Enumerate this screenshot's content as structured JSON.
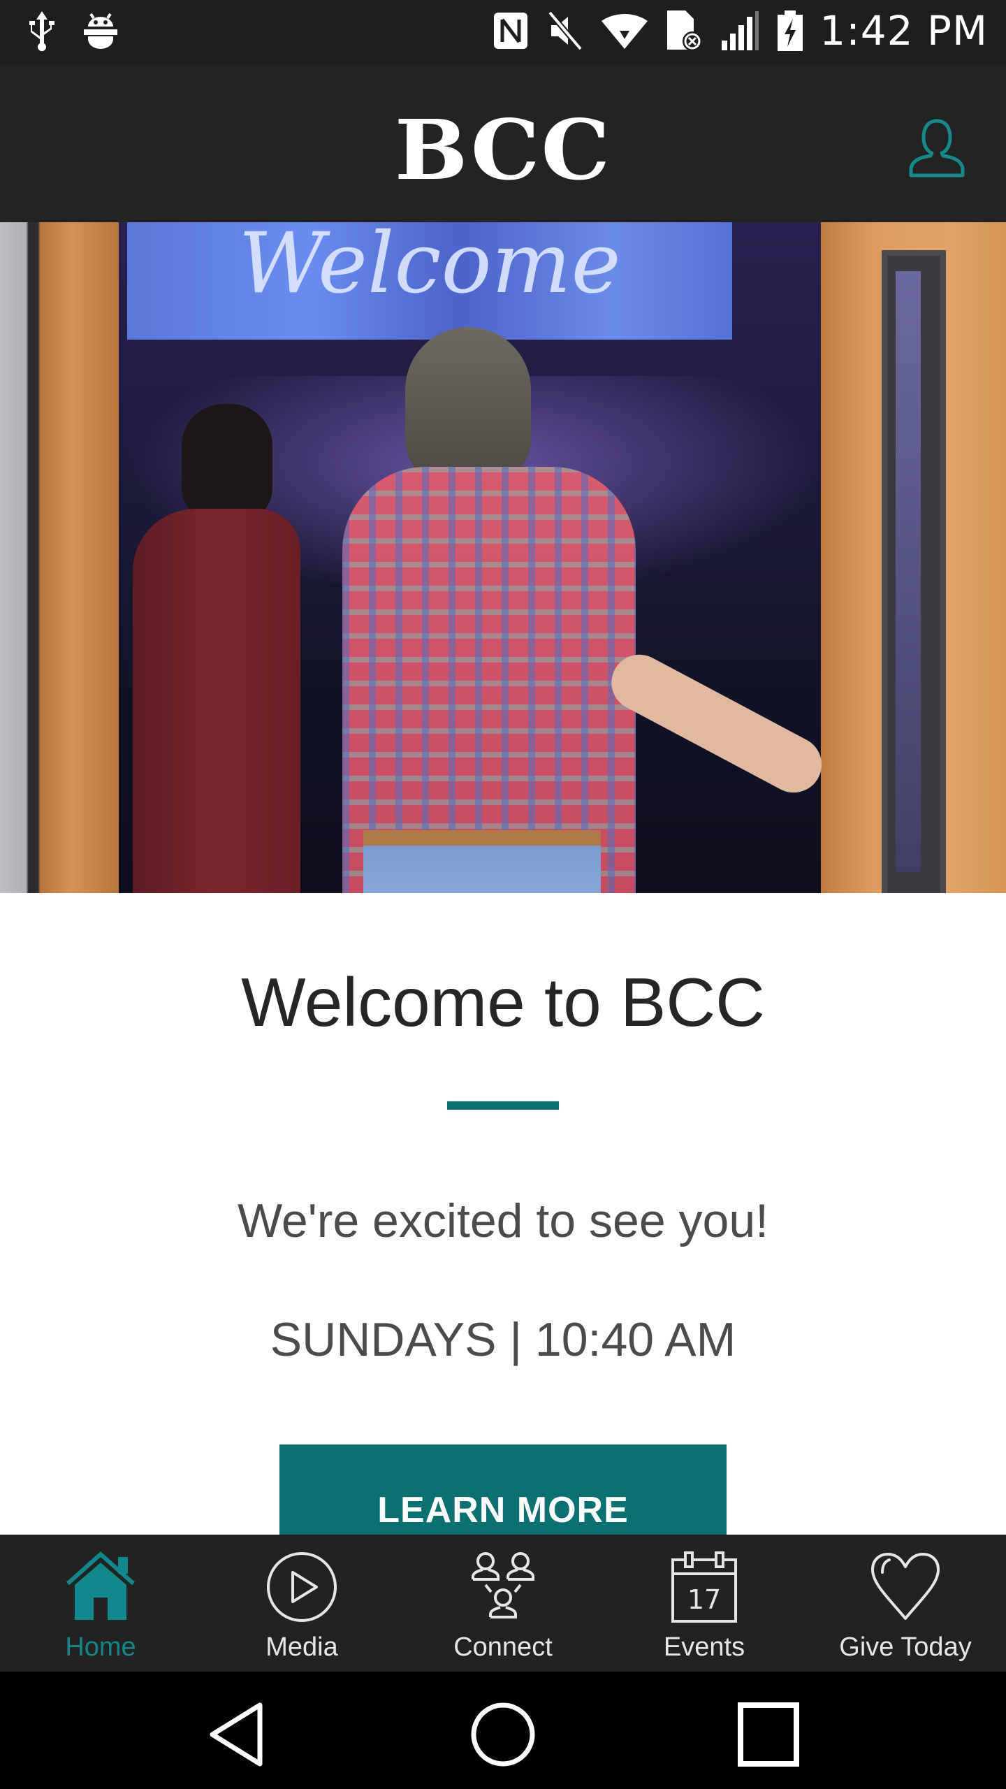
{
  "status_bar": {
    "left_icons": [
      "usb-icon",
      "android-debug-icon"
    ],
    "right_icons": [
      "nfc-icon",
      "mute-icon",
      "wifi-icon",
      "sim-missing-icon",
      "signal-icon",
      "battery-charging-icon"
    ],
    "time": "1:42 PM"
  },
  "header": {
    "logo": "BCC",
    "profile_icon": "person-icon"
  },
  "hero": {
    "screen_text": "Welcome",
    "image_alt": "People walking through open doors into a worship service"
  },
  "content": {
    "title": "Welcome to BCC",
    "tagline": "We're excited to see you!",
    "schedule": "SUNDAYS | 10:40 AM",
    "cta_label": "LEARN MORE"
  },
  "bottom_nav": {
    "items": [
      {
        "label": "Home",
        "icon": "home-icon",
        "active": true
      },
      {
        "label": "Media",
        "icon": "play-circle-icon",
        "active": false
      },
      {
        "label": "Connect",
        "icon": "group-icon",
        "active": false
      },
      {
        "label": "Events",
        "icon": "calendar-icon",
        "active": false,
        "icon_text": "17"
      },
      {
        "label": "Give Today",
        "icon": "heart-icon",
        "active": false
      }
    ]
  },
  "system_nav": [
    "back-icon",
    "home-circle-icon",
    "recents-icon"
  ],
  "colors": {
    "accent": "#0b7070",
    "accent_light": "#11898c",
    "header_bg": "#232323",
    "nav_bg": "#222222"
  }
}
